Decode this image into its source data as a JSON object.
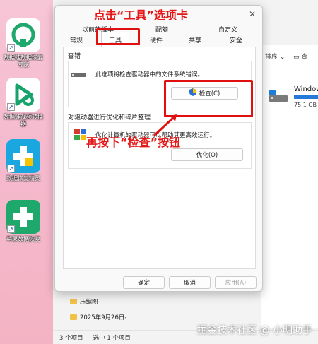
{
  "desktop": {
    "icons": [
      {
        "label": "数据蛙数据恢复专家",
        "icon": "data-recovery-app-icon",
        "color": "#1fa86b"
      },
      {
        "label": "数据蛙视频转换器",
        "icon": "video-converter-app-icon",
        "color": "#18a36d"
      },
      {
        "label": "数据恢复精灵",
        "icon": "recovery-wizard-app-icon",
        "color": "#1aa7e0"
      },
      {
        "label": "苹果数据恢复",
        "icon": "apple-recovery-app-icon",
        "color": "#1fa86b"
      }
    ]
  },
  "explorer": {
    "sort_label": "排序",
    "view_label": "查",
    "drive": {
      "name": "Window",
      "size": "75.1 GB"
    },
    "tree": [
      {
        "label": "压缩图",
        "icon": "folder-icon"
      },
      {
        "label": "2025年9月26日-",
        "icon": "folder-icon"
      }
    ],
    "status": {
      "count": "3 个项目",
      "selected": "选中 1 个项目"
    }
  },
  "dialog": {
    "tabs_top": [
      "以前的版本",
      "配额",
      "自定义"
    ],
    "tabs_bottom": [
      "常规",
      "工具",
      "硬件",
      "共享",
      "安全"
    ],
    "active_tab": "工具",
    "error_check": {
      "title": "查错",
      "description": "此选项将检查驱动器中的文件系统错误。",
      "button": "检查(C)"
    },
    "optimize": {
      "title": "对驱动器进行优化和碎片整理",
      "description": "优化计算机的驱动器可以帮助其更高效运行。",
      "button": "优化(O)"
    },
    "footer": {
      "ok": "确定",
      "cancel": "取消",
      "apply": "应用(A)"
    }
  },
  "annotations": {
    "tab_hint": "点击“工具”选项卡",
    "check_hint": "再按下“检查”按钮",
    "color": "#e01010"
  },
  "watermark": "掘金技术社区 @ 小明助手"
}
